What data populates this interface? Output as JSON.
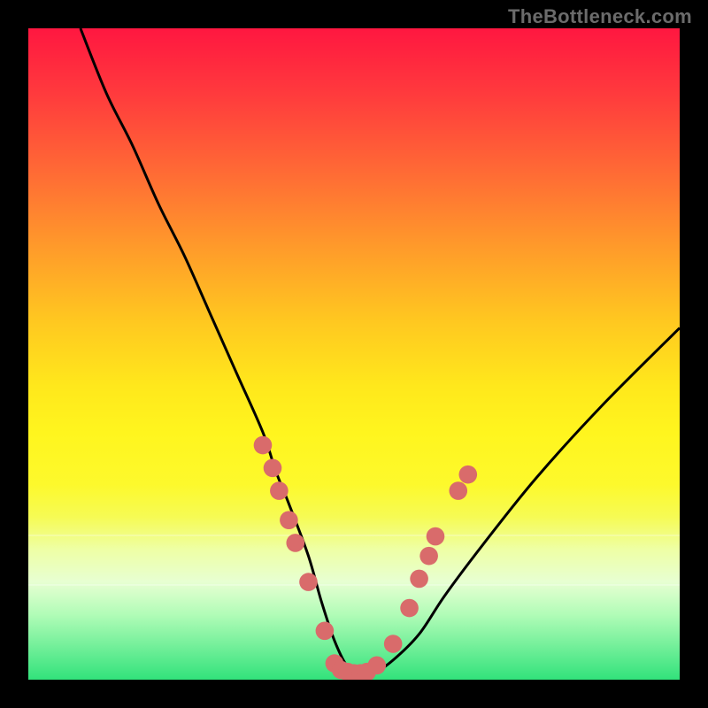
{
  "watermark": "TheBottleneck.com",
  "palette": {
    "black": "#000000",
    "curve": "#000000",
    "marker": "#d96b6b"
  },
  "chart_data": {
    "type": "line",
    "title": "",
    "xlabel": "",
    "ylabel": "",
    "xlim": [
      0,
      100
    ],
    "ylim": [
      0,
      100
    ],
    "series": [
      {
        "name": "bottleneck-curve",
        "x": [
          8,
          12,
          16,
          20,
          24,
          28,
          32,
          36,
          38,
          40,
          43,
          45,
          47,
          49,
          51,
          53,
          56,
          60,
          64,
          70,
          78,
          88,
          100
        ],
        "values": [
          100,
          90,
          82,
          73,
          65,
          56,
          47,
          38,
          32,
          27,
          19,
          12,
          6,
          2,
          1,
          1,
          3,
          7,
          13,
          21,
          31,
          42,
          54
        ]
      }
    ],
    "markers": {
      "name": "highlight-dots",
      "points": [
        {
          "x": 36.0,
          "y": 36.0
        },
        {
          "x": 37.5,
          "y": 32.5
        },
        {
          "x": 38.5,
          "y": 29.0
        },
        {
          "x": 40.0,
          "y": 24.5
        },
        {
          "x": 41.0,
          "y": 21.0
        },
        {
          "x": 43.0,
          "y": 15.0
        },
        {
          "x": 45.5,
          "y": 7.5
        },
        {
          "x": 47.0,
          "y": 2.5
        },
        {
          "x": 48.0,
          "y": 1.5
        },
        {
          "x": 49.0,
          "y": 1.2
        },
        {
          "x": 50.0,
          "y": 1.0
        },
        {
          "x": 51.0,
          "y": 1.0
        },
        {
          "x": 52.0,
          "y": 1.2
        },
        {
          "x": 53.5,
          "y": 2.2
        },
        {
          "x": 56.0,
          "y": 5.5
        },
        {
          "x": 58.5,
          "y": 11.0
        },
        {
          "x": 60.0,
          "y": 15.5
        },
        {
          "x": 61.5,
          "y": 19.0
        },
        {
          "x": 62.5,
          "y": 22.0
        },
        {
          "x": 66.0,
          "y": 29.0
        },
        {
          "x": 67.5,
          "y": 31.5
        }
      ],
      "radius_pct": 1.4
    }
  }
}
